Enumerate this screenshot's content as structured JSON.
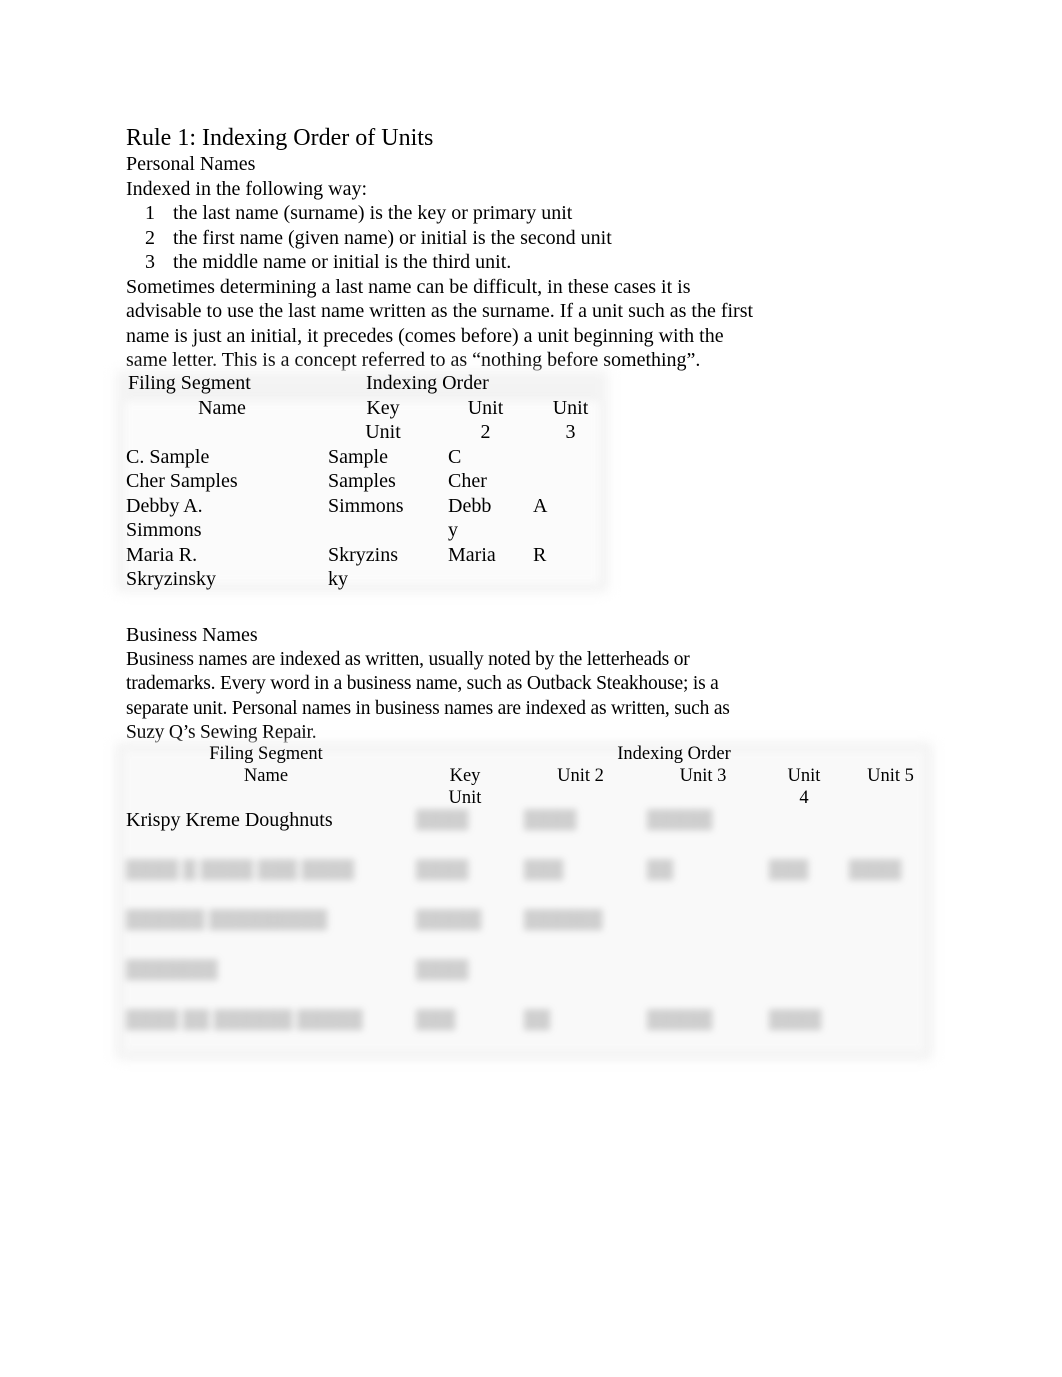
{
  "title": "Rule 1: Indexing Order of Units",
  "personal": {
    "heading": "Personal Names",
    "intro": "Indexed in the following way:",
    "steps": [
      {
        "num": "1",
        "text": "the last name (surname) is the key or primary unit"
      },
      {
        "num": "2",
        "text": "the first name (given name) or initial is the second unit"
      },
      {
        "num": "3",
        "text": "the middle name or initial is the third unit."
      }
    ],
    "paragraph": "Sometimes determining a last name can be difficult, in these cases it is advisable to use the last name written as the surname. If a unit such as the first name is just an initial, it precedes (comes before) a unit beginning with the same letter. This is a concept referred to as “nothing before something”.",
    "table": {
      "group_headers": {
        "filing_segment": "Filing Segment",
        "indexing_order": "Indexing Order"
      },
      "columns": [
        "Name",
        "Key Unit",
        "Unit 2",
        "Unit 3"
      ],
      "rows": [
        {
          "name": "C. Sample",
          "key": "Sample",
          "unit2": "C",
          "unit3": ""
        },
        {
          "name": "Cher Samples",
          "key": "Samples",
          "unit2": "Cher",
          "unit3": ""
        },
        {
          "name": "Debby A. Simmons",
          "key": "Simmons",
          "unit2": "Debby",
          "unit3": "A"
        },
        {
          "name": "Maria R. Skryzinsky",
          "key": "Skryzinsky",
          "unit2": "Maria",
          "unit3": "R"
        }
      ]
    }
  },
  "business": {
    "heading": "Business Names",
    "paragraph": "Business names are indexed as written, usually noted by the letterheads or trademarks. Every word in a business name, such as Outback Steakhouse; is a separate unit. Personal names in business names are indexed as written, such as Suzy Q’s Sewing Repair.",
    "table": {
      "group_headers": {
        "filing_segment": "Filing Segment",
        "indexing_order": "Indexing Order"
      },
      "columns": [
        "Name",
        "Key Unit",
        "Unit 2",
        "Unit 3",
        "Unit 4",
        "Unit 5"
      ],
      "rows": [
        {
          "name": "Krispy Kreme Doughnuts",
          "key": "▒▒▒▒",
          "unit2": "▒▒▒▒",
          "unit3": "▒▒▒▒▒",
          "unit4": "",
          "unit5": ""
        },
        {
          "name": "▒▒▒▒ ▒ ▒▒▒▒ ▒▒▒ ▒▒▒▒",
          "key": "▒▒▒▒",
          "unit2": "▒▒▒",
          "unit3": "▒▒",
          "unit4": "▒▒▒",
          "unit5": "▒▒▒▒"
        },
        {
          "name": "▒▒▒▒▒▒ ▒▒▒▒▒▒▒▒▒",
          "key": "▒▒▒▒▒",
          "unit2": "▒▒▒▒▒▒",
          "unit3": "",
          "unit4": "",
          "unit5": ""
        },
        {
          "name": "▒▒▒▒▒▒▒",
          "key": "▒▒▒▒",
          "unit2": "",
          "unit3": "",
          "unit4": "",
          "unit5": ""
        },
        {
          "name": "▒▒▒▒ ▒▒ ▒▒▒▒▒▒ ▒▒▒▒▒",
          "key": "▒▒▒",
          "unit2": "▒▒",
          "unit3": "▒▒▒▒▒",
          "unit4": "▒▒▒▒",
          "unit5": ""
        }
      ]
    }
  }
}
